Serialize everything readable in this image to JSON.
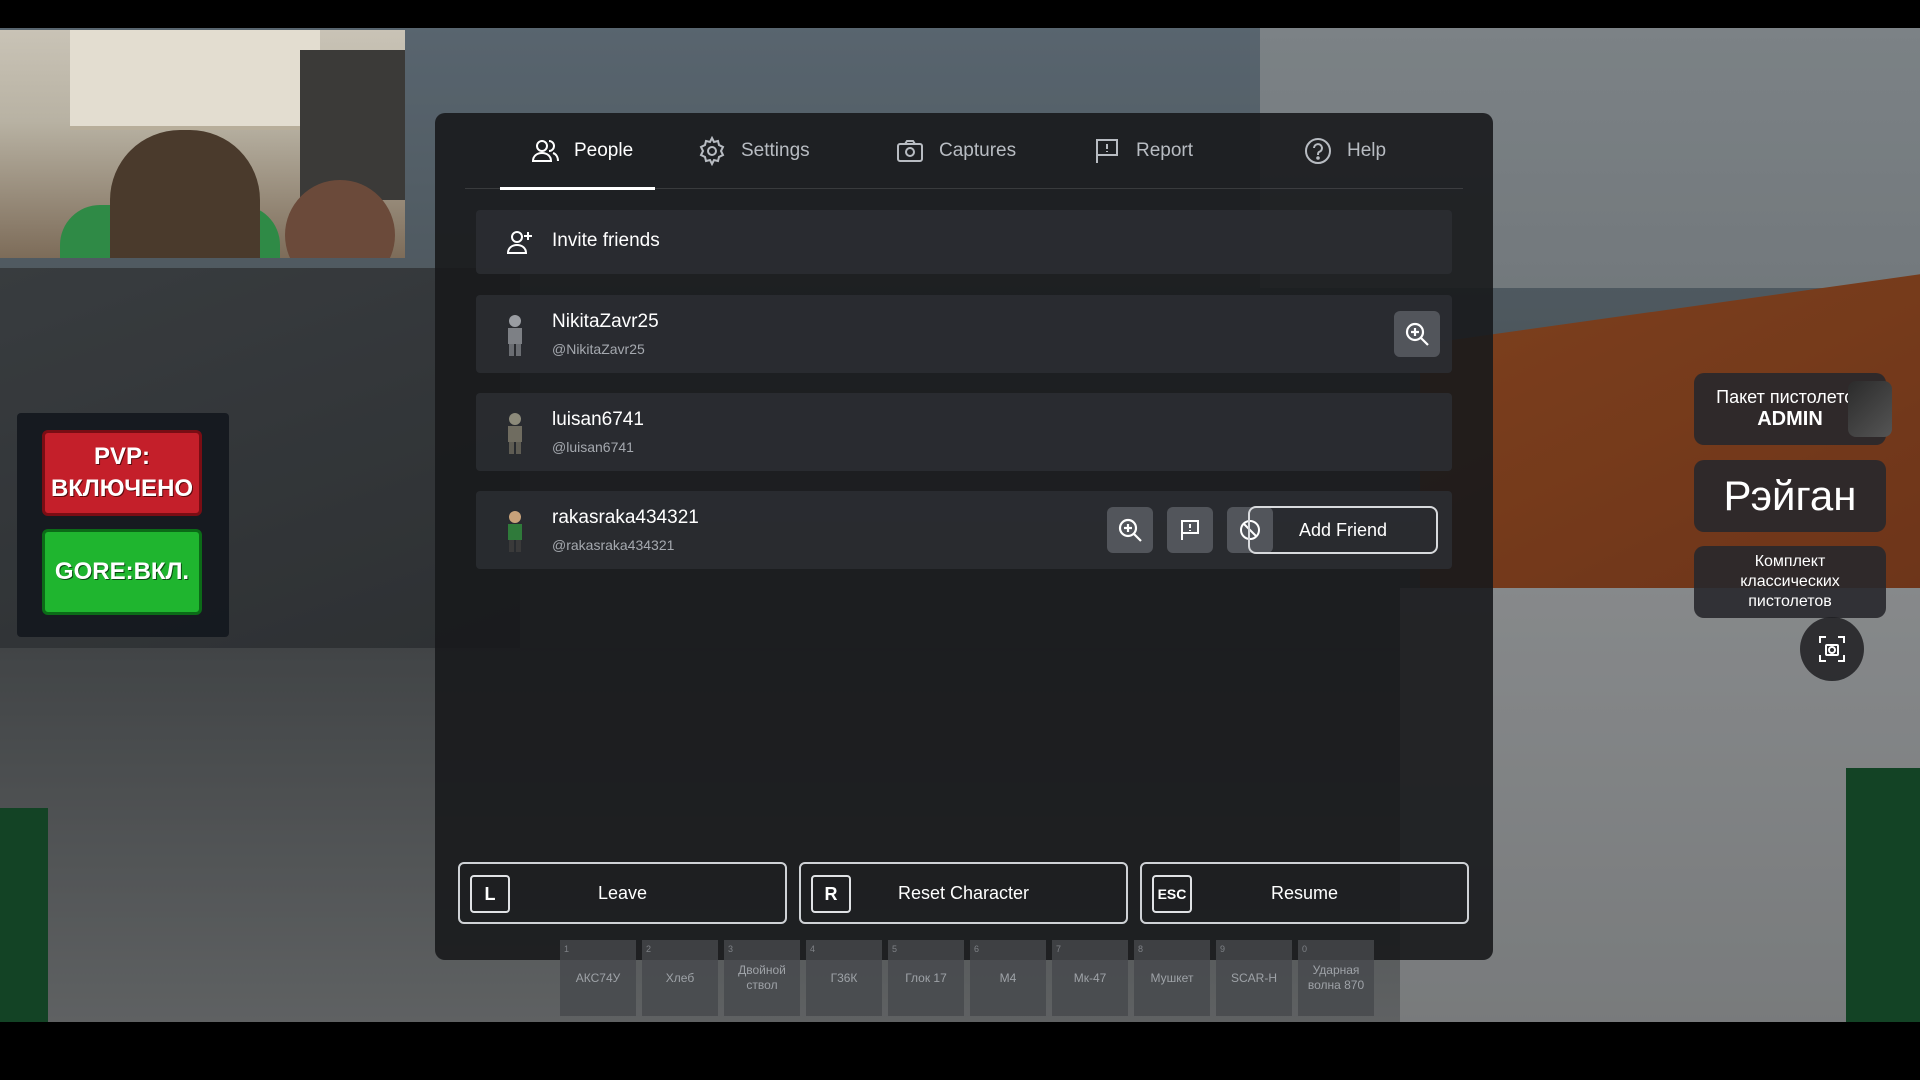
{
  "status": {
    "pvp_line1": "PVP:",
    "pvp_line2": "ВКЛЮЧЕНО",
    "gore": "GORE:ВКЛ."
  },
  "right_items": {
    "pack_admin_line1": "Пакет пистолетов",
    "pack_admin_line2": "ADMIN",
    "raygun": "Рэйган",
    "classic_line1": "Комплект",
    "classic_line2": "классических",
    "classic_line3": "пистолетов"
  },
  "tabs": [
    {
      "label": "People",
      "icon": "people-icon",
      "active": true
    },
    {
      "label": "Settings",
      "icon": "gear-icon"
    },
    {
      "label": "Captures",
      "icon": "camera-icon"
    },
    {
      "label": "Report",
      "icon": "flag-icon"
    },
    {
      "label": "Help",
      "icon": "help-icon"
    }
  ],
  "invite": {
    "label": "Invite friends",
    "icon": "add-person-icon"
  },
  "players": [
    {
      "name": "NikitaZavr25",
      "handle": "@NikitaZavr25"
    },
    {
      "name": "luisan6741",
      "handle": "@luisan6741"
    },
    {
      "name": "rakasraka434321",
      "handle": "@rakasraka434321",
      "add_friend": "Add Friend"
    }
  ],
  "bottom": [
    {
      "key": "L",
      "label": "Leave"
    },
    {
      "key": "R",
      "label": "Reset Character"
    },
    {
      "key": "ESC",
      "label": "Resume"
    }
  ],
  "hotbar": [
    {
      "num": "1",
      "label": "АКС74У"
    },
    {
      "num": "2",
      "label": "Хлеб"
    },
    {
      "num": "3",
      "label": "Двойной ствол"
    },
    {
      "num": "4",
      "label": "Г36К"
    },
    {
      "num": "5",
      "label": "Глок 17"
    },
    {
      "num": "6",
      "label": "M4"
    },
    {
      "num": "7",
      "label": "Мк-47"
    },
    {
      "num": "8",
      "label": "Мушкет"
    },
    {
      "num": "9",
      "label": "SCAR-H"
    },
    {
      "num": "0",
      "label": "Ударная волна 870"
    }
  ],
  "colors": {
    "pvp": "#c41f2a",
    "gore": "#1fb52f",
    "panel": "#18191c"
  }
}
